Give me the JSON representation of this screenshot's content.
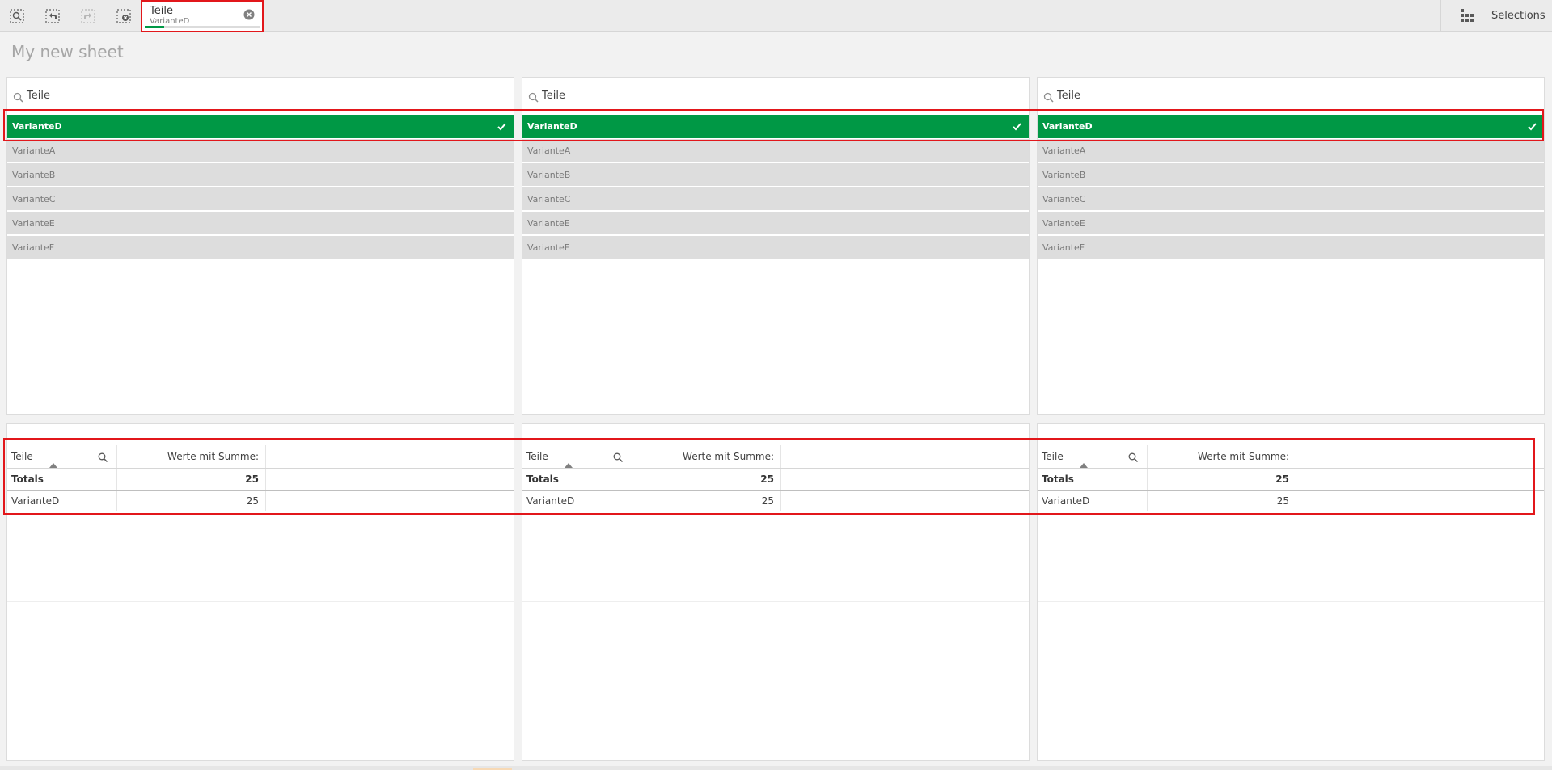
{
  "toolbar": {
    "tools": [
      {
        "name": "smart-search",
        "icon": "smart-search-icon",
        "enabled": true
      },
      {
        "name": "step-back",
        "icon": "step-back-icon",
        "enabled": true
      },
      {
        "name": "step-forward",
        "icon": "step-forward-icon",
        "enabled": false
      },
      {
        "name": "clear-selections",
        "icon": "clear-selections-icon",
        "enabled": true
      }
    ],
    "current_selection": {
      "field": "Teile",
      "value": "VarianteD",
      "selected_fraction": 0.17
    },
    "selections_label": "Selections"
  },
  "sheet": {
    "title": "My new sheet"
  },
  "filter_panes": [
    {
      "title": "Teile",
      "items": [
        {
          "label": "VarianteD",
          "state": "selected"
        },
        {
          "label": "VarianteA",
          "state": "alternative"
        },
        {
          "label": "VarianteB",
          "state": "alternative"
        },
        {
          "label": "VarianteC",
          "state": "alternative"
        },
        {
          "label": "VarianteE",
          "state": "alternative"
        },
        {
          "label": "VarianteF",
          "state": "alternative"
        }
      ]
    },
    {
      "title": "Teile",
      "items": [
        {
          "label": "VarianteD",
          "state": "selected"
        },
        {
          "label": "VarianteA",
          "state": "alternative"
        },
        {
          "label": "VarianteB",
          "state": "alternative"
        },
        {
          "label": "VarianteC",
          "state": "alternative"
        },
        {
          "label": "VarianteE",
          "state": "alternative"
        },
        {
          "label": "VarianteF",
          "state": "alternative"
        }
      ]
    },
    {
      "title": "Teile",
      "items": [
        {
          "label": "VarianteD",
          "state": "selected"
        },
        {
          "label": "VarianteA",
          "state": "alternative"
        },
        {
          "label": "VarianteB",
          "state": "alternative"
        },
        {
          "label": "VarianteC",
          "state": "alternative"
        },
        {
          "label": "VarianteE",
          "state": "alternative"
        },
        {
          "label": "VarianteF",
          "state": "alternative"
        }
      ]
    }
  ],
  "tables": [
    {
      "columns": [
        "Teile",
        "Werte mit Summe:"
      ],
      "totals": {
        "label": "Totals",
        "value": "25"
      },
      "rows": [
        {
          "label": "VarianteD",
          "value": "25"
        }
      ]
    },
    {
      "columns": [
        "Teile",
        "Werte mit Summe:"
      ],
      "totals": {
        "label": "Totals",
        "value": "25"
      },
      "rows": [
        {
          "label": "VarianteD",
          "value": "25"
        }
      ]
    },
    {
      "columns": [
        "Teile",
        "Werte mit Summe:"
      ],
      "totals": {
        "label": "Totals",
        "value": "25"
      },
      "rows": [
        {
          "label": "VarianteD",
          "value": "25"
        }
      ]
    }
  ],
  "colors": {
    "selected": "#009845",
    "alternative": "#dddddd",
    "highlight": "#e2171b"
  }
}
